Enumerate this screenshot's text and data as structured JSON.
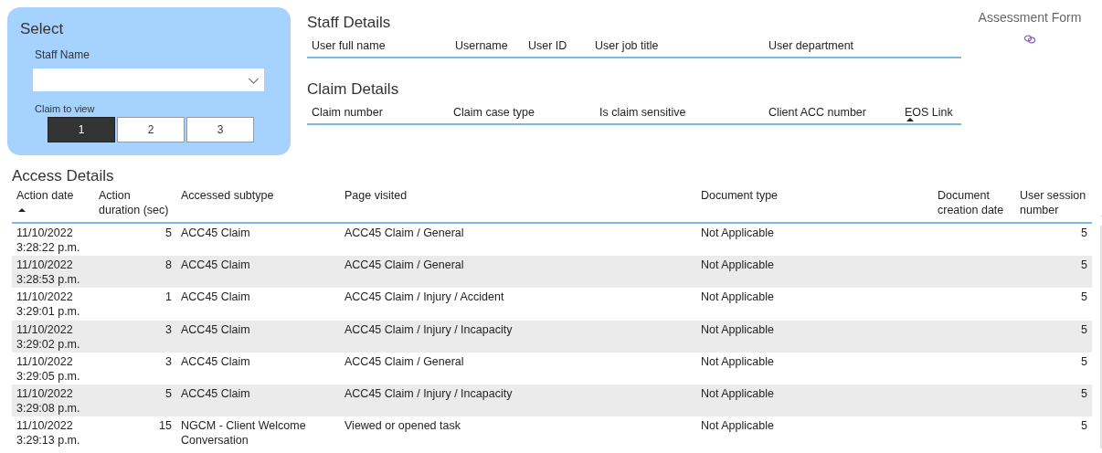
{
  "select_panel": {
    "title": "Select",
    "staff_name": {
      "label": "Staff Name"
    },
    "claim_to_view": {
      "label": "Claim to view",
      "options": [
        {
          "label": "1",
          "selected": true
        },
        {
          "label": "2",
          "selected": false
        },
        {
          "label": "3",
          "selected": false
        }
      ]
    }
  },
  "staff_details": {
    "title": "Staff Details",
    "columns": [
      {
        "label": "User full name",
        "sorted": false
      },
      {
        "label": "Username",
        "sorted": false
      },
      {
        "label": "User ID",
        "sorted": false
      },
      {
        "label": "User job title",
        "sorted": false
      },
      {
        "label": "User department",
        "sorted": false
      }
    ]
  },
  "claim_details": {
    "title": "Claim Details",
    "columns": [
      {
        "label": "Claim number",
        "sorted": false
      },
      {
        "label": "Claim case type",
        "sorted": false
      },
      {
        "label": "Is claim sensitive",
        "sorted": false
      },
      {
        "label": "Client ACC number",
        "sorted": false
      },
      {
        "label": "EOS Link",
        "sorted": true
      }
    ]
  },
  "assessment_form": {
    "title": "Assessment Form"
  },
  "access_details": {
    "title": "Access Details",
    "columns": [
      {
        "label": "Action date",
        "sorted": true
      },
      {
        "label": "Action duration (sec)",
        "sorted": false
      },
      {
        "label": "Accessed subtype",
        "sorted": false
      },
      {
        "label": "Page visited",
        "sorted": false
      },
      {
        "label": "Document type",
        "sorted": false
      },
      {
        "label": "Document creation date",
        "sorted": false
      },
      {
        "label": "User session number",
        "sorted": false
      }
    ],
    "rows": [
      [
        "11/10/2022 3:28:22 p.m.",
        "5",
        "ACC45 Claim",
        "ACC45 Claim / General",
        "Not Applicable",
        "",
        "5"
      ],
      [
        "11/10/2022 3:28:53 p.m.",
        "8",
        "ACC45 Claim",
        "ACC45 Claim / General",
        "Not Applicable",
        "",
        "5"
      ],
      [
        "11/10/2022 3:29:01 p.m.",
        "1",
        "ACC45 Claim",
        "ACC45 Claim / Injury / Accident",
        "Not Applicable",
        "",
        "5"
      ],
      [
        "11/10/2022 3:29:02 p.m.",
        "3",
        "ACC45 Claim",
        "ACC45 Claim / Injury / Incapacity",
        "Not Applicable",
        "",
        "5"
      ],
      [
        "11/10/2022 3:29:05 p.m.",
        "3",
        "ACC45 Claim",
        "ACC45 Claim / General",
        "Not Applicable",
        "",
        "5"
      ],
      [
        "11/10/2022 3:29:08 p.m.",
        "5",
        "ACC45 Claim",
        "ACC45 Claim / Injury / Incapacity",
        "Not Applicable",
        "",
        "5"
      ],
      [
        "11/10/2022 3:29:13 p.m.",
        "15",
        "NGCM - Client Welcome Conversation",
        "Viewed or opened task",
        "Not Applicable",
        "",
        "5"
      ]
    ]
  }
}
